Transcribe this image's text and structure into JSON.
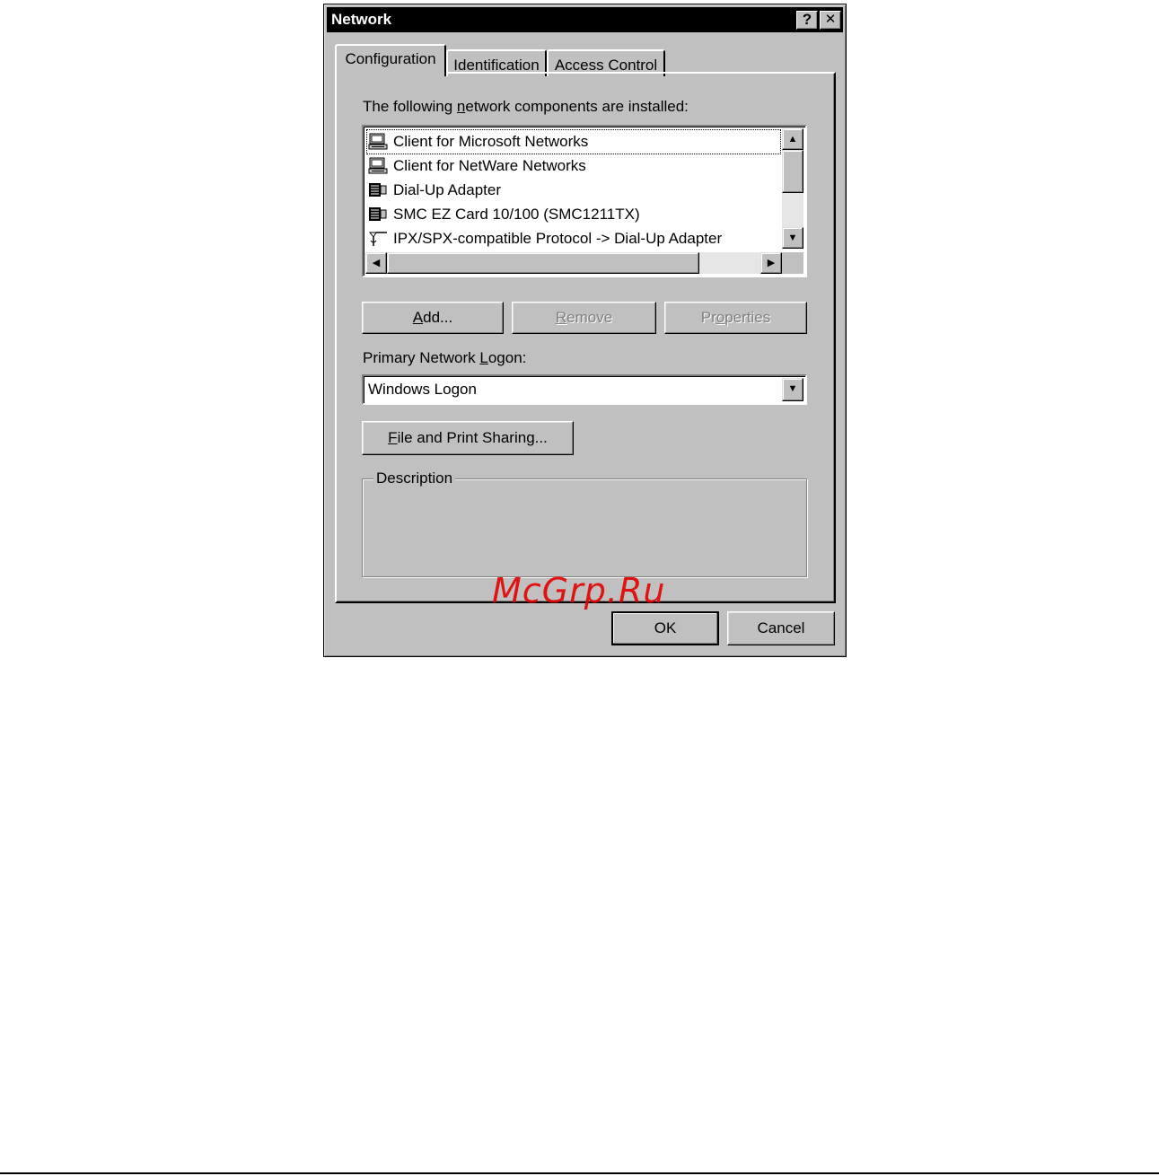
{
  "window": {
    "title": "Network",
    "help_glyph": "?",
    "close_glyph": "✕"
  },
  "tabs": [
    {
      "label": "Configuration",
      "active": true
    },
    {
      "label": "Identification",
      "active": false
    },
    {
      "label": "Access Control",
      "active": false
    }
  ],
  "components": {
    "label_pre": "The following ",
    "label_mnemonic": "n",
    "label_post": "etwork components are installed:",
    "items": [
      {
        "label": "Client for Microsoft Networks",
        "icon": "client-icon",
        "selected": true
      },
      {
        "label": "Client for NetWare Networks",
        "icon": "client-icon",
        "selected": false
      },
      {
        "label": "Dial-Up Adapter",
        "icon": "adapter-icon",
        "selected": false
      },
      {
        "label": "SMC EZ Card 10/100 (SMC1211TX)",
        "icon": "adapter-icon",
        "selected": false
      },
      {
        "label": "IPX/SPX-compatible Protocol -> Dial-Up Adapter",
        "icon": "protocol-icon",
        "selected": false
      }
    ]
  },
  "buttons": {
    "add_mnemonic": "A",
    "add_rest": "dd...",
    "remove_mnemonic": "R",
    "remove_rest": "emove",
    "properties_pre": "Pr",
    "properties_mnemonic": "o",
    "properties_rest": "perties",
    "file_print_mnemonic": "F",
    "file_print_rest": "ile and Print Sharing...",
    "ok": "OK",
    "cancel": "Cancel"
  },
  "logon": {
    "label_pre": "Primary Network ",
    "label_mnemonic": "L",
    "label_post": "ogon:",
    "value": "Windows Logon"
  },
  "description": {
    "label": "Description"
  },
  "watermark": "McGrp.Ru"
}
